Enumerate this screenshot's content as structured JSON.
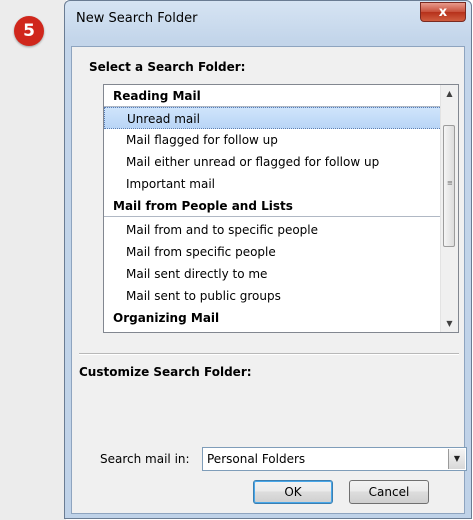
{
  "step_badge": "5",
  "dialog": {
    "title": "New Search Folder",
    "close_glyph": "x"
  },
  "select_section": {
    "label": "Select a Search Folder:",
    "groups": [
      {
        "header": "Reading Mail",
        "items": [
          {
            "label": "Unread mail",
            "selected": true
          },
          {
            "label": "Mail flagged for follow up",
            "selected": false
          },
          {
            "label": "Mail either unread or flagged for follow up",
            "selected": false
          },
          {
            "label": "Important mail",
            "selected": false
          }
        ]
      },
      {
        "header": "Mail from People and Lists",
        "items": [
          {
            "label": "Mail from and to specific people",
            "selected": false
          },
          {
            "label": "Mail from specific people",
            "selected": false
          },
          {
            "label": "Mail sent directly to me",
            "selected": false
          },
          {
            "label": "Mail sent to public groups",
            "selected": false
          }
        ]
      },
      {
        "header": "Organizing Mail",
        "items": []
      }
    ]
  },
  "customize_section": {
    "label": "Customize Search Folder:"
  },
  "search_mail_in": {
    "label": "Search mail in:",
    "value": "Personal Folders"
  },
  "buttons": {
    "ok": "OK",
    "cancel": "Cancel"
  },
  "colors": {
    "badge": "#d0271c",
    "selection": "#cfe4fb",
    "close_button": "#c74f3a"
  },
  "icons": {
    "scroll_up": "scroll-up-arrow-icon",
    "scroll_down": "scroll-down-arrow-icon",
    "dropdown": "chevron-down-icon"
  }
}
